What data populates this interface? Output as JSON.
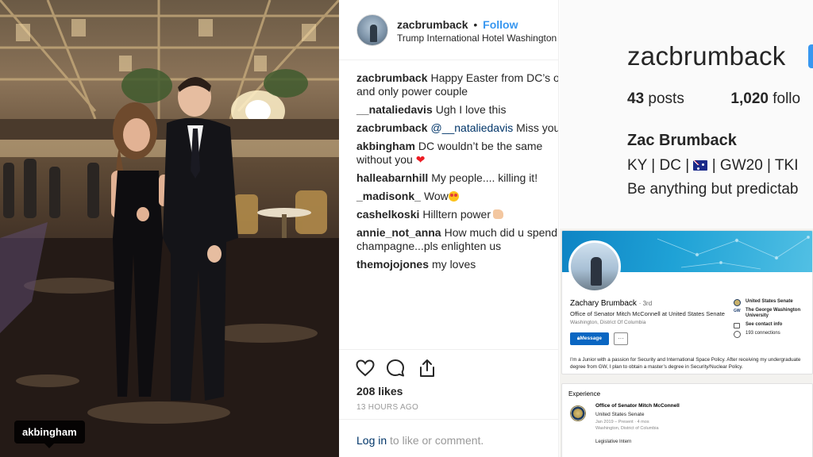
{
  "photo": {
    "tag_label": "akbingham"
  },
  "post": {
    "username": "zacbrumback",
    "separator": "•",
    "follow_label": "Follow",
    "location": "Trump International Hotel Washington",
    "comments": [
      {
        "user": "zacbrumback",
        "text": "Happy Easter from DC’s on",
        "text2": "and only power couple"
      },
      {
        "user": "__nataliedavis",
        "text": "Ugh I love this"
      },
      {
        "user": "zacbrumback",
        "mention": "@__nataliedavis",
        "text": "Miss you l"
      },
      {
        "user": "akbingham",
        "text": "DC wouldn’t be the same",
        "text2": "without you",
        "emoji": "❤"
      },
      {
        "user": "halleabarnhill",
        "text": "My people.... killing it!"
      },
      {
        "user": "_madisonk_",
        "text": "Wow"
      },
      {
        "user": "cashelkoski",
        "text": "Hilltern power"
      },
      {
        "user": "annie_not_anna",
        "text": "How much did u spend o",
        "text2": "champagne...pls enlighten us"
      },
      {
        "user": "themojojones",
        "text": "my loves"
      }
    ],
    "likes": "208 likes",
    "time_ago": "13 HOURS AGO",
    "login_link": "Log in",
    "login_rest": " to like or comment.",
    "icons": [
      "heart-icon",
      "comment-icon",
      "share-icon"
    ]
  },
  "profile": {
    "username": "zacbrumback",
    "posts_count": "43",
    "posts_label": "posts",
    "followers_count": "1,020",
    "followers_label": "follo",
    "full_name": "Zac Brumback",
    "bio_part1": "KY | DC |",
    "bio_part2": "| GW20 | TKI",
    "bio_line2": "Be anything but predictab"
  },
  "linkedin": {
    "name": "Zachary Brumback",
    "degree": "· 3rd",
    "headline": "Office of Senator Mitch McConnell at United States Senate",
    "location": "Washington, District Of Columbia",
    "message_label": "Message",
    "more_label": "···",
    "side": {
      "company": "United States Senate",
      "school": "The George Washington University",
      "school_abbr": "GW",
      "contact": "See contact info",
      "connections": "193 connections"
    },
    "about": "I’m a Junior with a passion for Security and International Space Policy. After receiving my undergraduate degree from GW, I plan to obtain a master’s degree in Security/Nuclear Policy.",
    "experience_title": "Experience",
    "exp_role": "Office of Senator Mitch McConnell",
    "exp_org": "United States Senate",
    "exp_dates": "Jan 2019 – Present · 4 mos",
    "exp_place": "Washington, District of Columbia",
    "exp_desc": "Legislative Intern",
    "colors": {
      "linkedin_blue": "#0a66c2",
      "instagram_blue": "#3897f0"
    }
  }
}
